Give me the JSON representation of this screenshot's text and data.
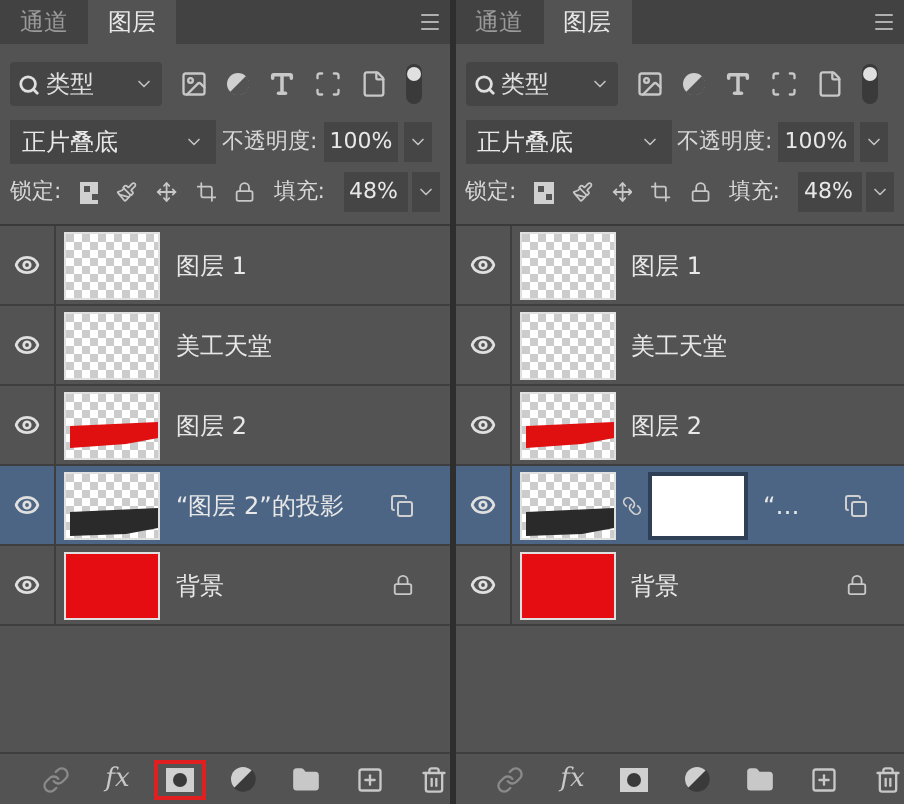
{
  "panels": [
    {
      "tabs": [
        {
          "label": "通道",
          "selected": false
        },
        {
          "label": "图层",
          "selected": true
        }
      ],
      "filter": "类型",
      "filter_on": true,
      "blend_mode": "正片叠底",
      "opacity_label": "不透明度:",
      "opacity": "100%",
      "lock_label": "锁定:",
      "fill_label": "填充:",
      "fill": "48%",
      "layers": [
        {
          "name": "图层 1",
          "kind": "transparent",
          "visible": true,
          "selected": false,
          "mask": false,
          "smart": false,
          "locked": false
        },
        {
          "name": "美工天堂",
          "kind": "transparent",
          "visible": true,
          "selected": false,
          "mask": false,
          "smart": false,
          "locked": false
        },
        {
          "name": "图层 2",
          "kind": "brush",
          "visible": true,
          "selected": false,
          "mask": false,
          "smart": false,
          "locked": false
        },
        {
          "name": "“图层 2”的投影",
          "kind": "shadow",
          "visible": true,
          "selected": true,
          "mask": false,
          "smart": true,
          "locked": false
        },
        {
          "name": "背景",
          "kind": "fill",
          "visible": true,
          "selected": false,
          "mask": false,
          "smart": false,
          "locked": true
        }
      ],
      "footer": [
        {
          "kind": "link",
          "highlighted": false
        },
        {
          "kind": "fx",
          "label": "fx",
          "highlighted": false
        },
        {
          "kind": "mask",
          "highlighted": true
        },
        {
          "kind": "adjust",
          "highlighted": false
        },
        {
          "kind": "folder",
          "highlighted": false
        },
        {
          "kind": "new",
          "highlighted": false
        },
        {
          "kind": "trash",
          "highlighted": false
        }
      ]
    },
    {
      "tabs": [
        {
          "label": "通道",
          "selected": false
        },
        {
          "label": "图层",
          "selected": true
        }
      ],
      "filter": "类型",
      "filter_on": true,
      "blend_mode": "正片叠底",
      "opacity_label": "不透明度:",
      "opacity": "100%",
      "lock_label": "锁定:",
      "fill_label": "填充:",
      "fill": "48%",
      "layers": [
        {
          "name": "图层 1",
          "kind": "transparent",
          "visible": true,
          "selected": false,
          "mask": false,
          "smart": false,
          "locked": false
        },
        {
          "name": "美工天堂",
          "kind": "transparent",
          "visible": true,
          "selected": false,
          "mask": false,
          "smart": false,
          "locked": false
        },
        {
          "name": "图层 2",
          "kind": "brush",
          "visible": true,
          "selected": false,
          "mask": false,
          "smart": false,
          "locked": false
        },
        {
          "name": "“…",
          "kind": "shadow",
          "visible": true,
          "selected": true,
          "mask": true,
          "smart": true,
          "locked": false
        },
        {
          "name": "背景",
          "kind": "fill",
          "visible": true,
          "selected": false,
          "mask": false,
          "smart": false,
          "locked": true
        }
      ],
      "footer": [
        {
          "kind": "link",
          "highlighted": false
        },
        {
          "kind": "fx",
          "label": "fx",
          "highlighted": false
        },
        {
          "kind": "mask",
          "highlighted": false
        },
        {
          "kind": "adjust",
          "highlighted": false
        },
        {
          "kind": "folder",
          "highlighted": false
        },
        {
          "kind": "new",
          "highlighted": false
        },
        {
          "kind": "trash",
          "highlighted": false
        }
      ]
    }
  ]
}
